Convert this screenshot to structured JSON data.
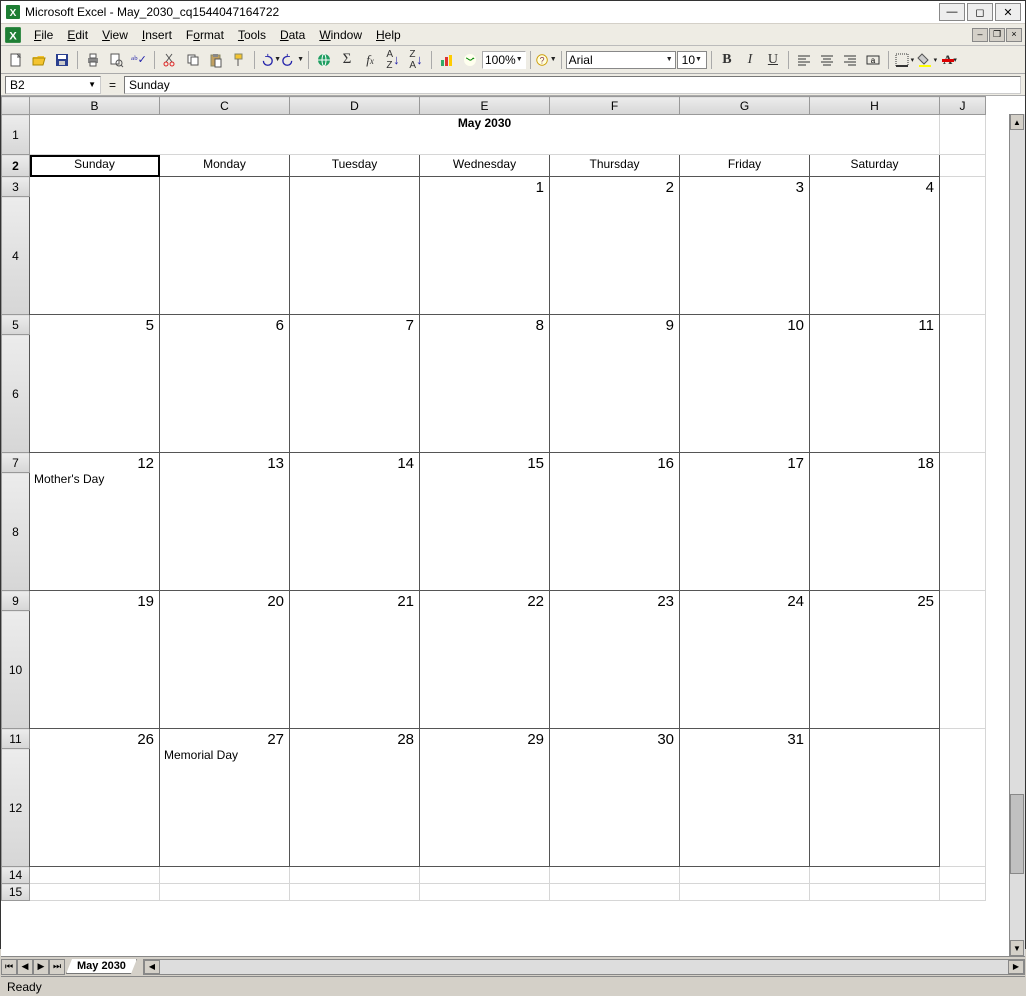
{
  "window": {
    "title": "Microsoft Excel - May_2030_cq1544047164722"
  },
  "menu": {
    "file": "File",
    "edit": "Edit",
    "view": "View",
    "insert": "Insert",
    "format": "Format",
    "tools": "Tools",
    "data": "Data",
    "window": "Window",
    "help": "Help"
  },
  "toolbar": {
    "zoom": "100%",
    "font": "Arial",
    "font_size": "10"
  },
  "namebox": {
    "ref": "B2",
    "formula": "Sunday",
    "eq": "="
  },
  "columns": [
    "B",
    "C",
    "D",
    "E",
    "F",
    "G",
    "H",
    "J"
  ],
  "row_headers": [
    "1",
    "2",
    "3",
    "4",
    "5",
    "6",
    "7",
    "8",
    "9",
    "10",
    "11",
    "12",
    "14",
    "15"
  ],
  "calendar": {
    "title": "May 2030",
    "days": [
      "Sunday",
      "Monday",
      "Tuesday",
      "Wednesday",
      "Thursday",
      "Friday",
      "Saturday"
    ],
    "weeks": [
      [
        {
          "n": "",
          "e": ""
        },
        {
          "n": "",
          "e": ""
        },
        {
          "n": "",
          "e": ""
        },
        {
          "n": "1",
          "e": ""
        },
        {
          "n": "2",
          "e": ""
        },
        {
          "n": "3",
          "e": ""
        },
        {
          "n": "4",
          "e": ""
        }
      ],
      [
        {
          "n": "5",
          "e": ""
        },
        {
          "n": "6",
          "e": ""
        },
        {
          "n": "7",
          "e": ""
        },
        {
          "n": "8",
          "e": ""
        },
        {
          "n": "9",
          "e": ""
        },
        {
          "n": "10",
          "e": ""
        },
        {
          "n": "11",
          "e": ""
        }
      ],
      [
        {
          "n": "12",
          "e": "Mother's Day"
        },
        {
          "n": "13",
          "e": ""
        },
        {
          "n": "14",
          "e": ""
        },
        {
          "n": "15",
          "e": ""
        },
        {
          "n": "16",
          "e": ""
        },
        {
          "n": "17",
          "e": ""
        },
        {
          "n": "18",
          "e": ""
        }
      ],
      [
        {
          "n": "19",
          "e": ""
        },
        {
          "n": "20",
          "e": ""
        },
        {
          "n": "21",
          "e": ""
        },
        {
          "n": "22",
          "e": ""
        },
        {
          "n": "23",
          "e": ""
        },
        {
          "n": "24",
          "e": ""
        },
        {
          "n": "25",
          "e": ""
        }
      ],
      [
        {
          "n": "26",
          "e": ""
        },
        {
          "n": "27",
          "e": "Memorial Day"
        },
        {
          "n": "28",
          "e": ""
        },
        {
          "n": "29",
          "e": ""
        },
        {
          "n": "30",
          "e": ""
        },
        {
          "n": "31",
          "e": ""
        },
        {
          "n": "",
          "e": ""
        }
      ]
    ]
  },
  "sheet_tab": "May 2030",
  "status": "Ready"
}
